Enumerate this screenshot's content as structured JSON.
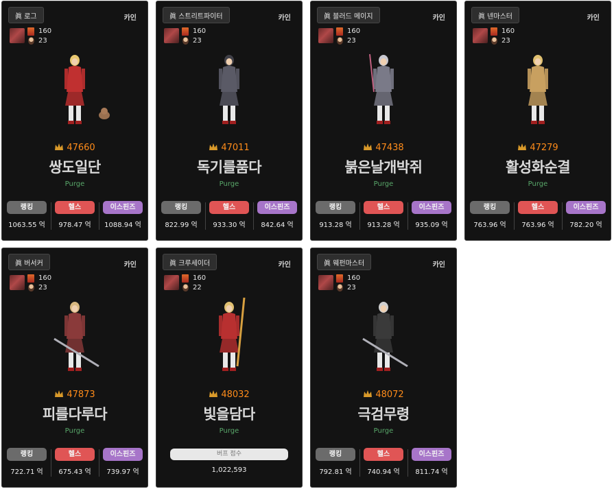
{
  "labels": {
    "rank": "랭킹",
    "haste": "헬스",
    "ispinz": "이스핀즈",
    "buff_score": "버프 점수"
  },
  "cards": [
    {
      "job": "眞 로그",
      "server": "카인",
      "level": "160",
      "sub": "23",
      "fame": "47660",
      "name": "쌍도일단",
      "guild": "Purge",
      "rank": "1063.55 억",
      "haste": "978.47 억",
      "ispinz": "1088.94 억",
      "accent": "#c03030"
    },
    {
      "job": "眞 스트리트파이터",
      "server": "카인",
      "level": "160",
      "sub": "23",
      "fame": "47011",
      "name": "독기를품다",
      "guild": "Purge",
      "rank": "822.99 억",
      "haste": "933.30 억",
      "ispinz": "842.64 억",
      "accent": "#5a5a66"
    },
    {
      "job": "眞 블러드 메이지",
      "server": "카인",
      "level": "160",
      "sub": "23",
      "fame": "47438",
      "name": "붉은날개박쥐",
      "guild": "Purge",
      "rank": "913.28 억",
      "haste": "913.28 억",
      "ispinz": "935.09 억",
      "accent": "#7a7a88"
    },
    {
      "job": "眞 넨마스터",
      "server": "카인",
      "level": "160",
      "sub": "23",
      "fame": "47279",
      "name": "활성화순결",
      "guild": "Purge",
      "rank": "763.96 억",
      "haste": "763.96 억",
      "ispinz": "782.20 억",
      "accent": "#c8a060"
    },
    {
      "job": "眞 버서커",
      "server": "카인",
      "level": "160",
      "sub": "23",
      "fame": "47873",
      "name": "피를다루다",
      "guild": "Purge",
      "rank": "722.71 억",
      "haste": "675.43 억",
      "ispinz": "739.97 억",
      "accent": "#8a3a3a"
    },
    {
      "job": "眞 크루세이더",
      "server": "카인",
      "level": "160",
      "sub": "22",
      "fame": "48032",
      "name": "빛을담다",
      "guild": "Purge",
      "buff": "1,022,593",
      "accent": "#b83030"
    },
    {
      "job": "眞 웨펀마스터",
      "server": "카인",
      "level": "160",
      "sub": "23",
      "fame": "48072",
      "name": "극검무령",
      "guild": "Purge",
      "rank": "792.81 억",
      "haste": "740.94 억",
      "ispinz": "811.74 억",
      "accent": "#3a3a3a"
    }
  ],
  "colors": {
    "fame": "#ff8c1a",
    "guild": "#59a86a",
    "card_bg": "#131313"
  }
}
